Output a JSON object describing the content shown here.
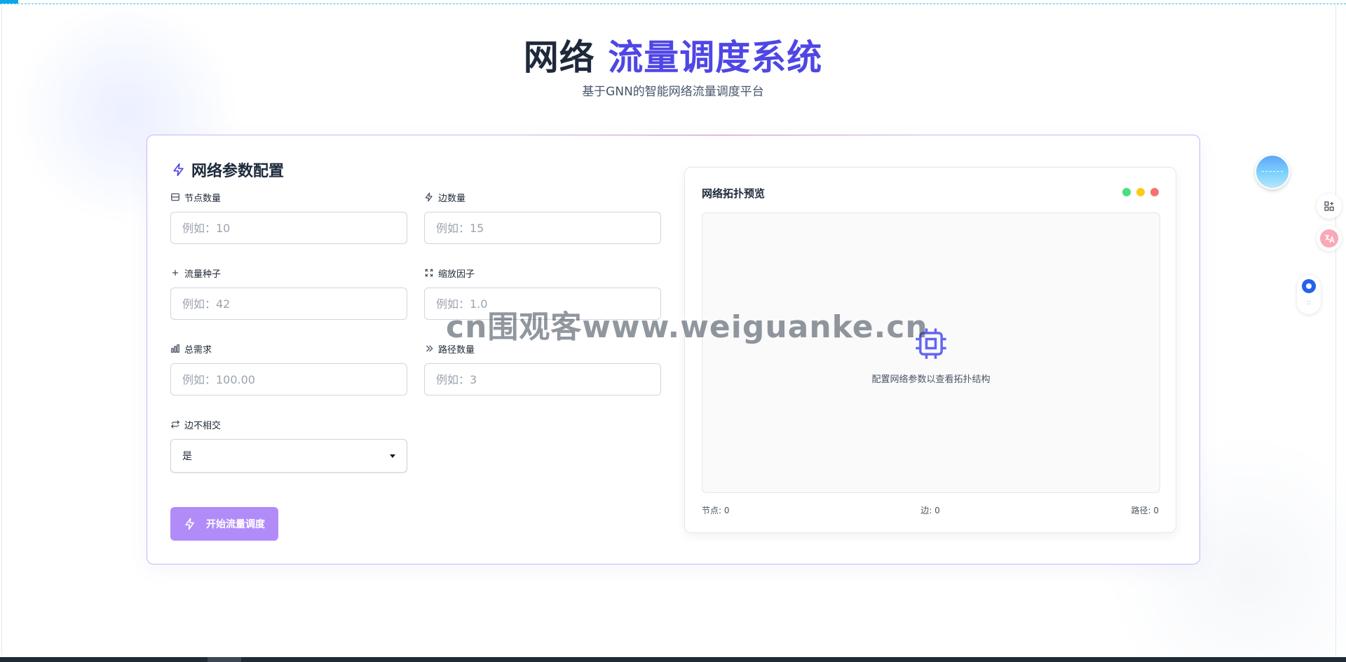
{
  "header": {
    "title_part1": "网络",
    "title_part2": "流量调度系统",
    "subtitle": "基于GNN的智能网络流量调度平台"
  },
  "config": {
    "title": "网络参数配置",
    "fields": {
      "nodes": {
        "label": "节点数量",
        "placeholder": "例如：10"
      },
      "edges": {
        "label": "边数量",
        "placeholder": "例如：15"
      },
      "seed": {
        "label": "流量种子",
        "placeholder": "例如：42"
      },
      "scale": {
        "label": "缩放因子",
        "placeholder": "例如：1.0"
      },
      "demand": {
        "label": "总需求",
        "placeholder": "例如：100.00"
      },
      "paths": {
        "label": "路径数量",
        "placeholder": "例如：3"
      },
      "disjoint": {
        "label": "边不相交",
        "value": "是"
      }
    },
    "start_button": "开始流量调度"
  },
  "preview": {
    "title": "网络拓扑预览",
    "empty_text": "配置网络参数以查看拓扑结构",
    "stats": {
      "nodes": "节点: 0",
      "edges": "边: 0",
      "paths": "路径: 0"
    },
    "dot_colors": [
      "#4ade80",
      "#facc15",
      "#f87171"
    ]
  },
  "watermark": "cn围观客www.weiguanke.cn",
  "colors": {
    "accent": "#4f46e5",
    "button": "#b18cf8",
    "card_border": "#c4b5fd"
  }
}
